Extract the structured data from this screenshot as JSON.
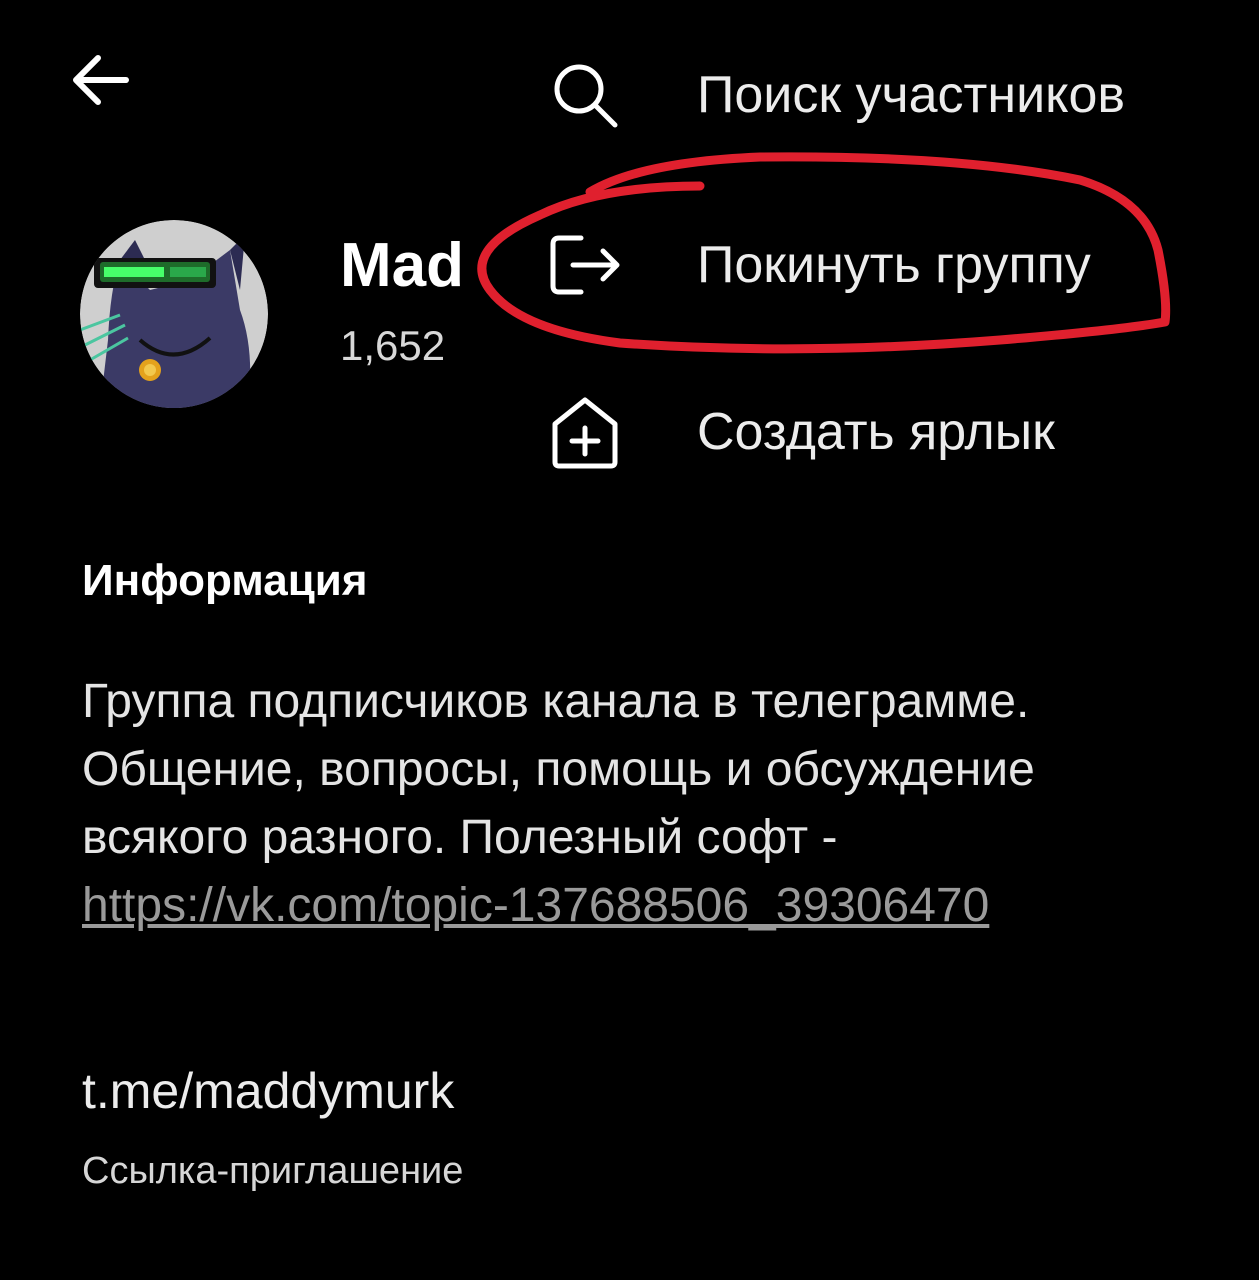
{
  "header": {
    "back_icon": "arrow-left-icon"
  },
  "group": {
    "title": "Mad",
    "count": "1,652 "
  },
  "menu": {
    "items": [
      {
        "icon": "search-icon",
        "label": "Поиск участников"
      },
      {
        "icon": "logout-icon",
        "label": "Покинуть группу"
      },
      {
        "icon": "add-shortcut-icon",
        "label": "Создать ярлык"
      }
    ]
  },
  "info": {
    "heading": "Информация",
    "description_text": "Группа подписчиков канала в телеграмме. Общение, вопросы, помощь и обсуждение всякого разного. Полезный софт - ",
    "description_link": "https://vk.com/topic-137688506_39306470",
    "link": "t.me/maddymurk",
    "link_caption": "Ссылка-приглашение"
  },
  "colors": {
    "background": "#000000",
    "text": "#e9e9e9",
    "link_muted": "#9a9a9a",
    "annotation": "#e0202e"
  }
}
